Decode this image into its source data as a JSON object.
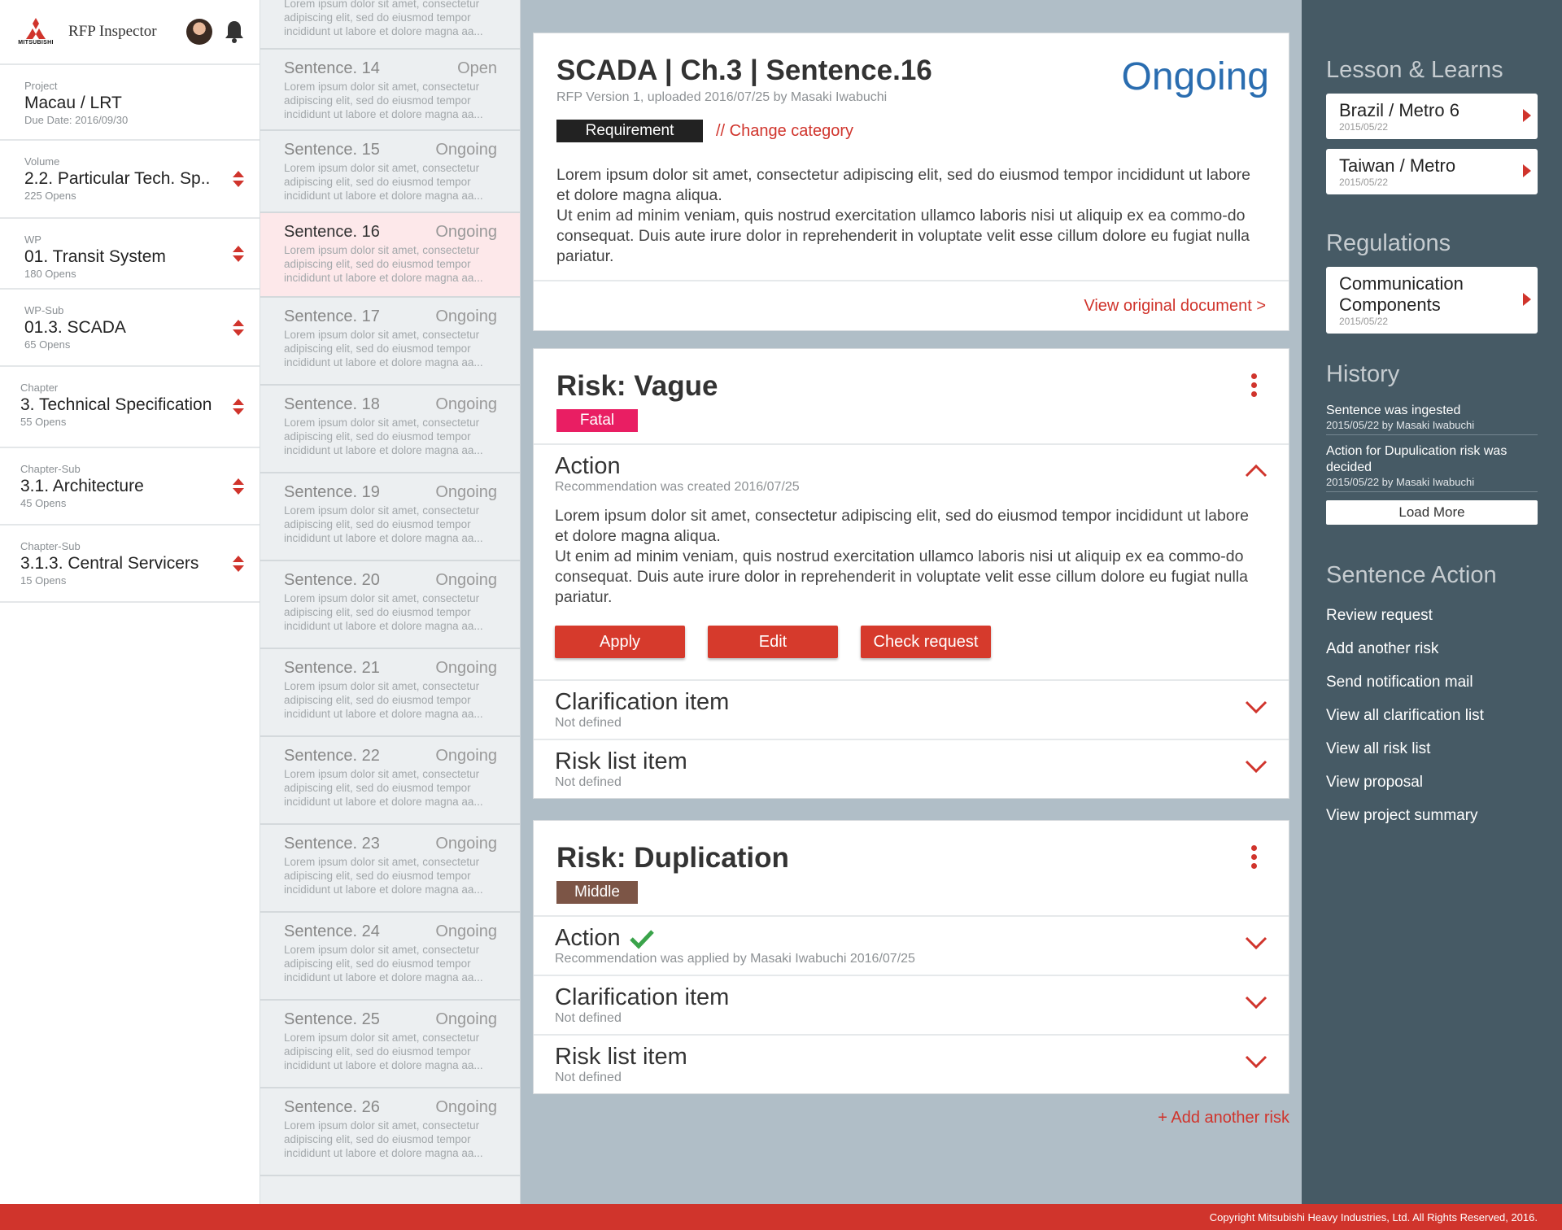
{
  "header": {
    "logo_text": "MITSUBISHI",
    "app_title": "RFP Inspector"
  },
  "nav": [
    {
      "key": "Project",
      "value": "Macau / LRT",
      "sub": "Due Date: 2016/09/30"
    },
    {
      "key": "Volume",
      "value": "2.2. Particular Tech. Sp..",
      "sub": "225 Opens"
    },
    {
      "key": "WP",
      "value": "01. Transit System",
      "sub": "180 Opens"
    },
    {
      "key": "WP-Sub",
      "value": "01.3. SCADA",
      "sub": "65 Opens"
    },
    {
      "key": "Chapter",
      "value": "3. Technical Specification",
      "sub": "55 Opens"
    },
    {
      "key": "Chapter-Sub",
      "value": "3.1. Architecture",
      "sub": "45 Opens"
    },
    {
      "key": "Chapter-Sub",
      "value": "3.1.3. Central Servicers",
      "sub": "15 Opens"
    }
  ],
  "sentences": {
    "top_preview": "Lorem ipsum dolor sit amet, consectetur adipiscing elit, sed do eiusmod tempor incididunt ut labore et dolore magna aa...",
    "items": [
      {
        "title": "Sentence. 14",
        "status": "Open",
        "preview": "Lorem ipsum dolor sit amet, consectetur adipiscing elit, sed do eiusmod tempor incididunt ut labore et dolore magna aa..."
      },
      {
        "title": "Sentence. 15",
        "status": "Ongoing",
        "preview": "Lorem ipsum dolor sit amet, consectetur adipiscing elit, sed do eiusmod tempor incididunt ut labore et dolore magna aa..."
      },
      {
        "title": "Sentence. 16",
        "status": "Ongoing",
        "preview": "Lorem ipsum dolor sit amet, consectetur adipiscing elit, sed do eiusmod tempor incididunt ut labore et dolore magna aa..."
      },
      {
        "title": "Sentence. 17",
        "status": "Ongoing",
        "preview": "Lorem ipsum dolor sit amet, consectetur adipiscing elit, sed do eiusmod tempor incididunt ut labore et dolore magna aa..."
      },
      {
        "title": "Sentence. 18",
        "status": "Ongoing",
        "preview": "Lorem ipsum dolor sit amet, consectetur adipiscing elit, sed do eiusmod tempor incididunt ut labore et dolore magna aa..."
      },
      {
        "title": "Sentence. 19",
        "status": "Ongoing",
        "preview": "Lorem ipsum dolor sit amet, consectetur adipiscing elit, sed do eiusmod tempor incididunt ut labore et dolore magna aa..."
      },
      {
        "title": "Sentence. 20",
        "status": "Ongoing",
        "preview": "Lorem ipsum dolor sit amet, consectetur adipiscing elit, sed do eiusmod tempor incididunt ut labore et dolore magna aa..."
      },
      {
        "title": "Sentence. 21",
        "status": "Ongoing",
        "preview": "Lorem ipsum dolor sit amet, consectetur adipiscing elit, sed do eiusmod tempor incididunt ut labore et dolore magna aa..."
      },
      {
        "title": "Sentence. 22",
        "status": "Ongoing",
        "preview": "Lorem ipsum dolor sit amet, consectetur adipiscing elit, sed do eiusmod tempor incididunt ut labore et dolore magna aa..."
      },
      {
        "title": "Sentence. 23",
        "status": "Ongoing",
        "preview": "Lorem ipsum dolor sit amet, consectetur adipiscing elit, sed do eiusmod tempor incididunt ut labore et dolore magna aa..."
      },
      {
        "title": "Sentence. 24",
        "status": "Ongoing",
        "preview": "Lorem ipsum dolor sit amet, consectetur adipiscing elit, sed do eiusmod tempor incididunt ut labore et dolore magna aa..."
      },
      {
        "title": "Sentence. 25",
        "status": "Ongoing",
        "preview": "Lorem ipsum dolor sit amet, consectetur adipiscing elit, sed do eiusmod tempor incididunt ut labore et dolore magna aa..."
      },
      {
        "title": "Sentence. 26",
        "status": "Ongoing",
        "preview": "Lorem ipsum dolor sit amet, consectetur adipiscing elit, sed do eiusmod tempor incididunt ut labore et dolore magna aa..."
      }
    ]
  },
  "detail": {
    "title": "SCADA | Ch.3 | Sentence.16",
    "meta": "RFP Version 1, uploaded 2016/07/25 by Masaki Iwabuchi",
    "status": "Ongoing",
    "category": "Requirement",
    "change_category": "// Change category",
    "paragraph1": "Lorem ipsum dolor sit amet, consectetur adipiscing elit, sed do eiusmod tempor incididunt ut labore et dolore magna aliqua.",
    "paragraph2": "Ut enim ad minim veniam, quis nostrud exercitation ullamco laboris nisi ut aliquip ex ea commo-do consequat. Duis aute irure dolor in reprehenderit in voluptate velit esse cillum dolore eu fugiat nulla pariatur.",
    "view_original": "View original document >"
  },
  "risk_vague": {
    "title": "Risk: Vague",
    "severity": "Fatal",
    "action_title": "Action",
    "action_sub": "Recommendation was created 2016/07/25",
    "action_p1": "Lorem ipsum dolor sit amet, consectetur adipiscing elit, sed do eiusmod tempor incididunt ut labore et dolore magna aliqua.",
    "action_p2": "Ut enim ad minim veniam, quis nostrud exercitation ullamco laboris nisi ut aliquip ex ea commo-do consequat. Duis aute irure dolor in reprehenderit in voluptate velit esse cillum dolore eu fugiat nulla pariatur.",
    "btn_apply": "Apply",
    "btn_edit": "Edit",
    "btn_check": "Check request",
    "clar_title": "Clarification item",
    "clar_sub": "Not defined",
    "risklist_title": "Risk list item",
    "risklist_sub": "Not defined"
  },
  "risk_dup": {
    "title": "Risk: Duplication",
    "severity": "Middle",
    "action_title": "Action",
    "action_sub": "Recommendation was applied by Masaki Iwabuchi 2016/07/25",
    "clar_title": "Clarification item",
    "clar_sub": "Not defined",
    "risklist_title": "Risk list item",
    "risklist_sub": "Not defined"
  },
  "add_risk": "+ Add another risk",
  "right": {
    "lessons_heading": "Lesson & Learns",
    "lessons": [
      {
        "title": "Brazil / Metro 6",
        "date": "2015/05/22"
      },
      {
        "title": "Taiwan / Metro",
        "date": "2015/05/22"
      }
    ],
    "regulations_heading": "Regulations",
    "regulations": [
      {
        "title": "Communication Components",
        "date": "2015/05/22"
      }
    ],
    "history_heading": "History",
    "history": [
      {
        "text": "Sentence was ingested",
        "date": "2015/05/22 by Masaki Iwabuchi"
      },
      {
        "text": "Action for Dupulication risk was decided",
        "date": "2015/05/22 by Masaki Iwabuchi"
      }
    ],
    "load_more": "Load More",
    "actions_heading": "Sentence Action",
    "actions": [
      "Review request",
      "Add another risk",
      "Send notification mail",
      "View all clarification list",
      "View all risk list",
      "View proposal",
      "View project summary"
    ]
  },
  "footer": "Copyright Mitsubishi Heavy Industries, Ltd. All Rights Reserved, 2016.",
  "colors": {
    "accent_red": "#d0342c",
    "status_blue": "#2a6db0",
    "fatal": "#e91e63",
    "middle": "#7c5546",
    "panel": "#465a65"
  }
}
